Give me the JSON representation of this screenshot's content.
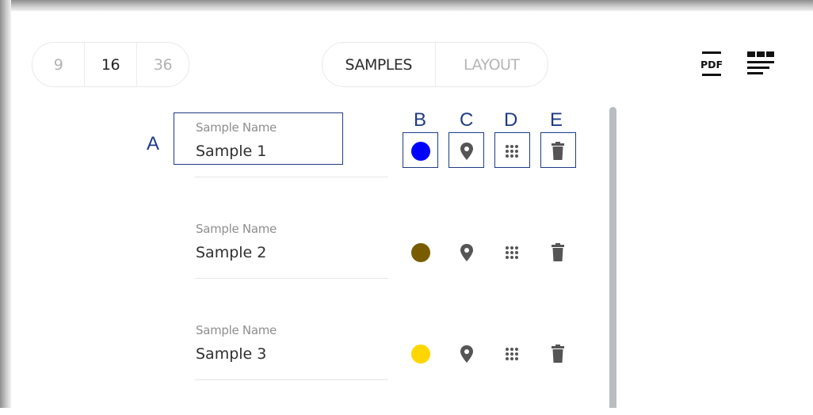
{
  "size_selector": {
    "options": [
      "9",
      "16",
      "36"
    ],
    "selected": "16"
  },
  "view_tabs": {
    "options": [
      "SAMPLES",
      "LAYOUT"
    ],
    "selected": "SAMPLES"
  },
  "toolbar": {
    "pdf_label": "PDF",
    "pdf_icon": "pdf-export-icon",
    "layout_icon": "layout-grid-icon"
  },
  "samples": [
    {
      "label": "Sample Name",
      "value": "Sample 1",
      "color": "#0000ff"
    },
    {
      "label": "Sample Name",
      "value": "Sample 2",
      "color": "#7a5c00"
    },
    {
      "label": "Sample Name",
      "value": "Sample 3",
      "color": "#ffd600"
    }
  ],
  "row_icons": {
    "color": "color-dot-icon",
    "location": "location-pin-icon",
    "grid": "grid-dots-icon",
    "delete": "trash-icon"
  },
  "callouts": {
    "a": "A",
    "b": "B",
    "c": "C",
    "d": "D",
    "e": "E"
  }
}
